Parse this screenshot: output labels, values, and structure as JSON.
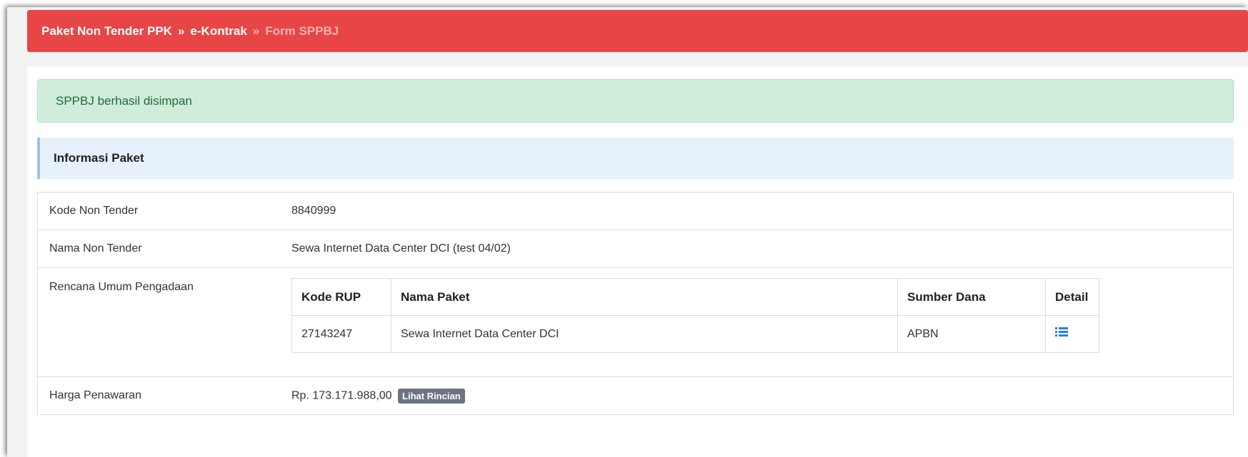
{
  "breadcrumb": {
    "item1": "Paket Non Tender PPK",
    "item2": "e-Kontrak",
    "current": "Form SPPBJ",
    "separator": "»"
  },
  "alert": {
    "message": "SPPBJ berhasil disimpan"
  },
  "section": {
    "title": "Informasi Paket"
  },
  "info": {
    "kode_label": "Kode Non Tender",
    "kode_value": "8840999",
    "nama_label": "Nama Non Tender",
    "nama_value": "Sewa Internet Data Center DCI (test 04/02)",
    "rup_label": "Rencana Umum Pengadaan",
    "harga_label": "Harga Penawaran",
    "harga_value": "Rp. 173.171.988,00",
    "harga_button": "Lihat Rincian"
  },
  "rup_table": {
    "headers": [
      "Kode RUP",
      "Nama Paket",
      "Sumber Dana",
      "Detail"
    ],
    "rows": [
      {
        "kode": "27143247",
        "nama": "Sewa Internet Data Center DCI",
        "sumber": "APBN",
        "detail_icon": "list-icon"
      }
    ]
  },
  "colors": {
    "header": "#e84646",
    "alert_bg": "#d0eddc",
    "alert_text": "#1f6b33",
    "section_bg": "#e7f1fb",
    "icon_blue": "#2a7de1",
    "badge": "#6b7480"
  }
}
